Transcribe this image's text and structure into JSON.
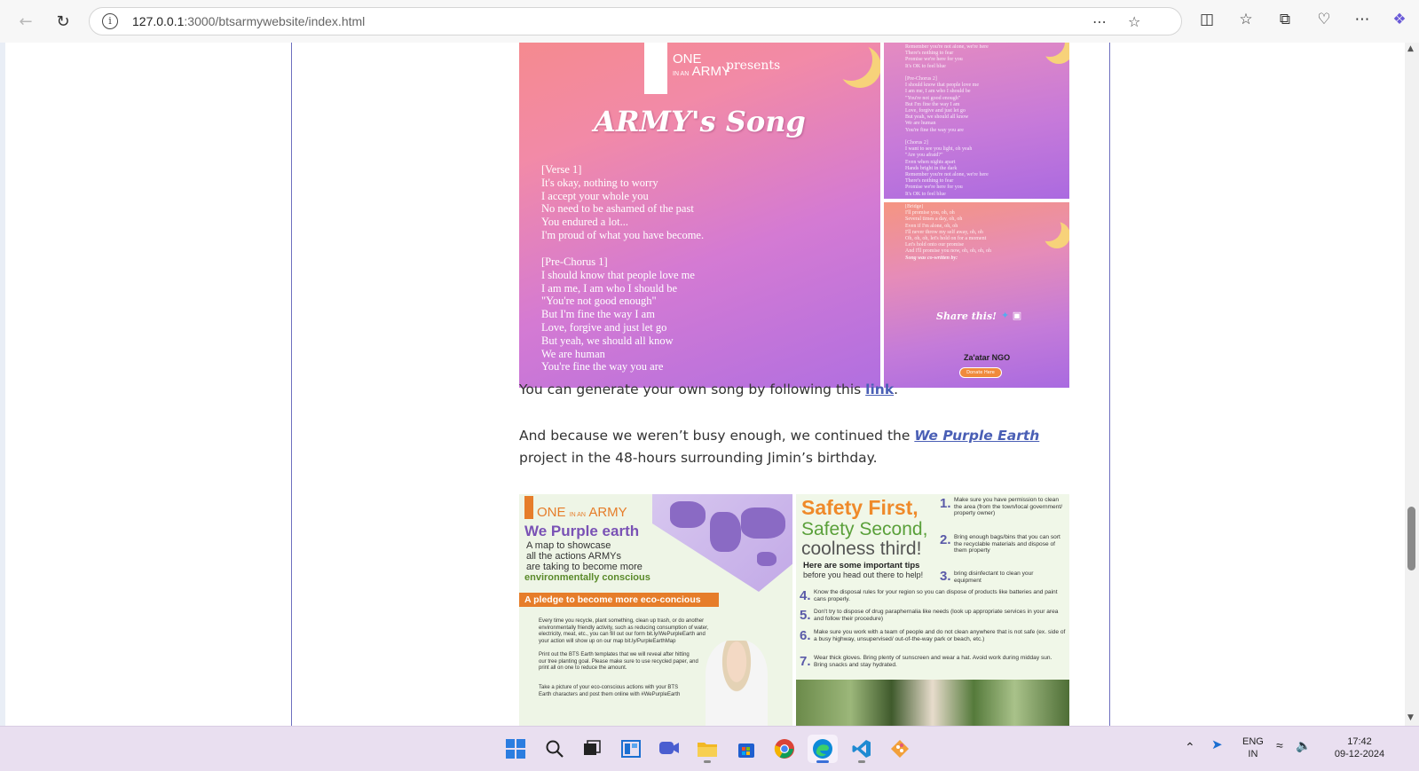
{
  "browser": {
    "url_host": "127.0.0.1",
    "url_rest": ":3000/btsarmywebsite/index.html",
    "icons": [
      "back-icon",
      "refresh-icon",
      "site-info-icon",
      "read-aloud-icon",
      "favorite-star-icon",
      "split-screen-icon",
      "favorites-icon",
      "collections-icon",
      "browser-essentials-icon",
      "more-icon",
      "copilot-icon"
    ]
  },
  "song_image": {
    "brand": "ONE",
    "brand_small": "IN AN",
    "brand_army": "ARMY",
    "presents": "presents",
    "title": "ARMY's Song",
    "verse_lyrics": "[Verse 1]\nIt's okay, nothing to worry\nI accept your whole you\nNo need to be ashamed of the past\nYou endured a lot...\nI'm proud of what you have become.",
    "prechorus_lyrics": "[Pre-Chorus 1]\nI should know that people love me\nI am me, I am who I should be\n\"You're not good enough\"\nBut I'm fine the way I am\nLove, forgive and just let go\nBut yeah, we should all know\nWe are human\nYou're fine the way you are",
    "side_lyrics_top": "Remember you're not alone, we're here\nThere's nothing to fear\nPromise we're here for you\nIt's OK to feel blue\n\n[Pre-Chorus 2]\nI should know that people love me\nI am me, I am who I should be\n\"You're not good enough\"\nBut I'm fine the way I am\nLove, forgive and just let go\nBut yeah, we should all know\nWe are human\nYou're fine the way you are\n\n[Chorus 2]\nI want to see you light, oh yeah\n\"Are you afraid?\"\nEven when nights apart\nHands bright in the dark\nRemember you're not alone, we're here\nThere's nothing to fear\nPromise we're here for you\nIt's OK to feel blue",
    "side_lyrics_bottom": "[Bridge]\nI'll promise you, oh, oh\nSeveral times a day, oh, oh\nEven if I'm alone, oh, oh\nI'll never throw my self away, oh, oh\nOh, oh, oh, let's hold on for a moment\nLet's hold onto our promise\nAnd I'll promise you now, oh, oh, oh, oh",
    "written_by": "Song was co-written by:",
    "share": "Share this!",
    "ngo": "Za'atar NGO",
    "donate": "Donate Here"
  },
  "paragraphs": {
    "generate_prefix": "You can generate your own song by following this ",
    "generate_link": "link",
    "generate_suffix": ".",
    "purple_prefix": "And because we weren’t busy enough, we continued the ",
    "purple_link": "We Purple Earth",
    "purple_suffix": "project in the 48-hours surrounding Jimin’s birthday."
  },
  "earth_left": {
    "brand_one": "ONE",
    "brand_small": "IN AN",
    "brand_army": "ARMY",
    "title": "We Purple earth",
    "desc_lines": [
      "A map to showcase",
      "all the actions ARMYs",
      "are taking to become more"
    ],
    "desc_green": "environmentally conscious",
    "pledge": "A pledge to become more eco-concious",
    "bullets": [
      "Every time you recycle, plant something, clean up trash, or do another environmentally friendly activity, such as reducing consumption of water, electricity, meat, etc., you can fill out our form bit.ly/WePurpleEarth and your action will show up on our map bit.ly/PurpleEarthMap",
      "Print out the BTS Earth templates that we will reveal after hitting our tree planting goal. Please make sure to use recycled paper, and print all on one to reduce the amount.",
      "Take a picture of your eco-conscious actions with your BTS Earth characters and post them online with #WePurpleEarth"
    ]
  },
  "earth_right": {
    "title": "Safety First,",
    "sub1": "Safety Second,",
    "sub2": "coolness third!",
    "tips": "Here are some important tips",
    "tips2": "before you head out there to help!",
    "rules": [
      {
        "num": "1.",
        "text": "Make sure you have permission to clean the area (from the town/local government/ property owner)"
      },
      {
        "num": "2.",
        "text": "Bring enough bags/bins that you can sort the recyclable materials and dispose of them property"
      },
      {
        "num": "3.",
        "text": "bring disinfectant to clean your equipment"
      },
      {
        "num": "4.",
        "text": "Know the disposal rules for your region so you can dispose of products like batteries and paint cans properly."
      },
      {
        "num": "5.",
        "text": "Don't try to dispose of drug paraphernalia like needs (look up appropriate services in your area and follow their procedure)"
      },
      {
        "num": "6.",
        "text": "Make sure you work with a team of people and do not clean anywhere that is not safe (ex. side of a busy highway, unsupervised/ out-of-the-way park or beach, etc.)"
      },
      {
        "num": "7.",
        "text": "Wear thick gloves. Bring plenty of sunscreen and wear a hat. Avoid work during midday sun. Bring snacks and stay hydrated."
      }
    ]
  },
  "taskbar": {
    "apps": [
      "windows-start-icon",
      "search-icon",
      "task-view-icon",
      "widgets-icon",
      "zoom-icon",
      "file-explorer-icon",
      "store-icon",
      "chrome-icon",
      "edge-icon",
      "vscode-icon",
      "git-icon"
    ],
    "lang_top": "ENG",
    "lang_bottom": "IN",
    "time": "17:42",
    "date": "09-12-2024"
  },
  "colors": {
    "link": "#4a5fb5",
    "border": "#6d6fbf",
    "taskbar": "#e9dff0"
  }
}
